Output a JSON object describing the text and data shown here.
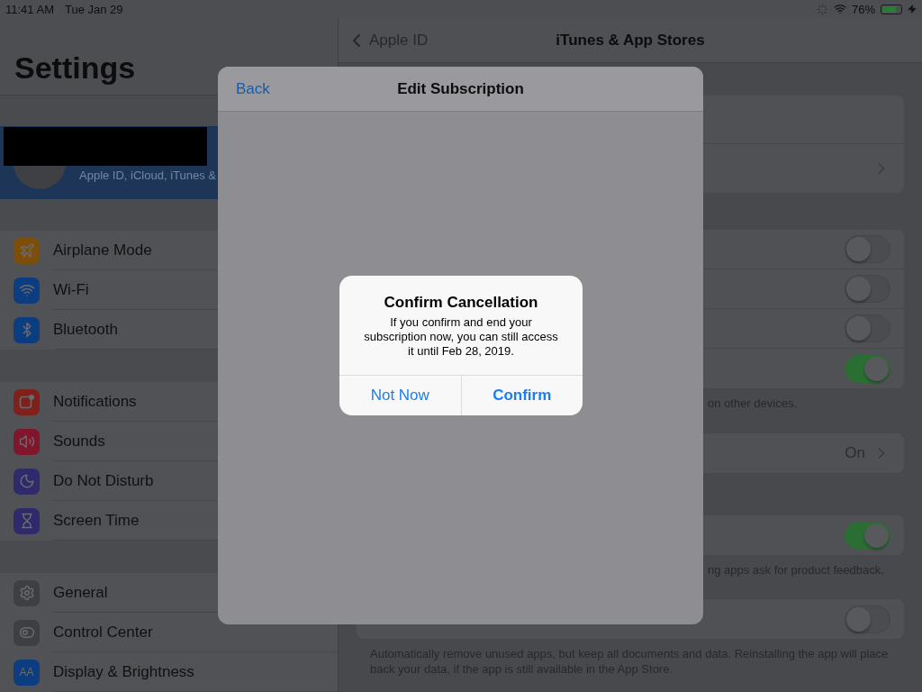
{
  "status_bar": {
    "time": "11:41 AM",
    "date": "Tue Jan 29",
    "battery": "76%"
  },
  "sidebar": {
    "title": "Settings",
    "account": {
      "subtitle": "Apple ID, iCloud, iTunes &",
      "selected": true
    },
    "groups": [
      [
        {
          "label": "Airplane Mode",
          "color": "#7d4e0a"
        },
        {
          "label": "Wi-Fi",
          "color": "#0b3d80"
        },
        {
          "label": "Bluetooth",
          "color": "#0b3d80"
        }
      ],
      [
        {
          "label": "Notifications",
          "color": "#80201b"
        },
        {
          "label": "Sounds",
          "color": "#80162c"
        },
        {
          "label": "Do Not Disturb",
          "color": "#2f2a6b"
        },
        {
          "label": "Screen Time",
          "color": "#2f2a6b"
        }
      ],
      [
        {
          "label": "General",
          "color": "#3e3f42"
        },
        {
          "label": "Control Center",
          "color": "#3e3f42"
        },
        {
          "label": "Display & Brightness",
          "color": "#0b3d80",
          "icon_text": "AA"
        }
      ]
    ]
  },
  "detail": {
    "back": "Apple ID",
    "title": "iTunes & App Stores",
    "groups": [
      {
        "tall": true,
        "rows": [
          {
            "kind": "blank"
          },
          {
            "kind": "chevron"
          }
        ]
      },
      {
        "rows": [
          {
            "kind": "toggle",
            "on": false
          },
          {
            "kind": "toggle",
            "on": false
          },
          {
            "kind": "toggle",
            "on": false
          },
          {
            "kind": "toggle",
            "on": true
          }
        ],
        "footer": {
          "kind": "partial",
          "text": "on other devices."
        }
      },
      {
        "rows": [
          {
            "kind": "chevron",
            "value": "On"
          }
        ]
      },
      {
        "rows": [
          {
            "kind": "toggle",
            "on": true
          }
        ],
        "footer": {
          "kind": "partial",
          "text": "ng apps ask for product feedback."
        }
      },
      {
        "rows": [
          {
            "kind": "toggle",
            "on": false
          }
        ],
        "footer": {
          "kind": "full",
          "text": "Automatically remove unused apps, but keep all documents and data. Reinstalling the app will place back your data, if the app is still available in the App Store."
        }
      }
    ]
  },
  "sheet": {
    "back": "Back",
    "title": "Edit Subscription"
  },
  "alert": {
    "title": "Confirm Cancellation",
    "message": "If you confirm and end your subscription now, you can still access it until Feb 28, 2019.",
    "buttons": [
      {
        "label": "Not Now",
        "bold": false
      },
      {
        "label": "Confirm",
        "bold": true
      }
    ]
  }
}
